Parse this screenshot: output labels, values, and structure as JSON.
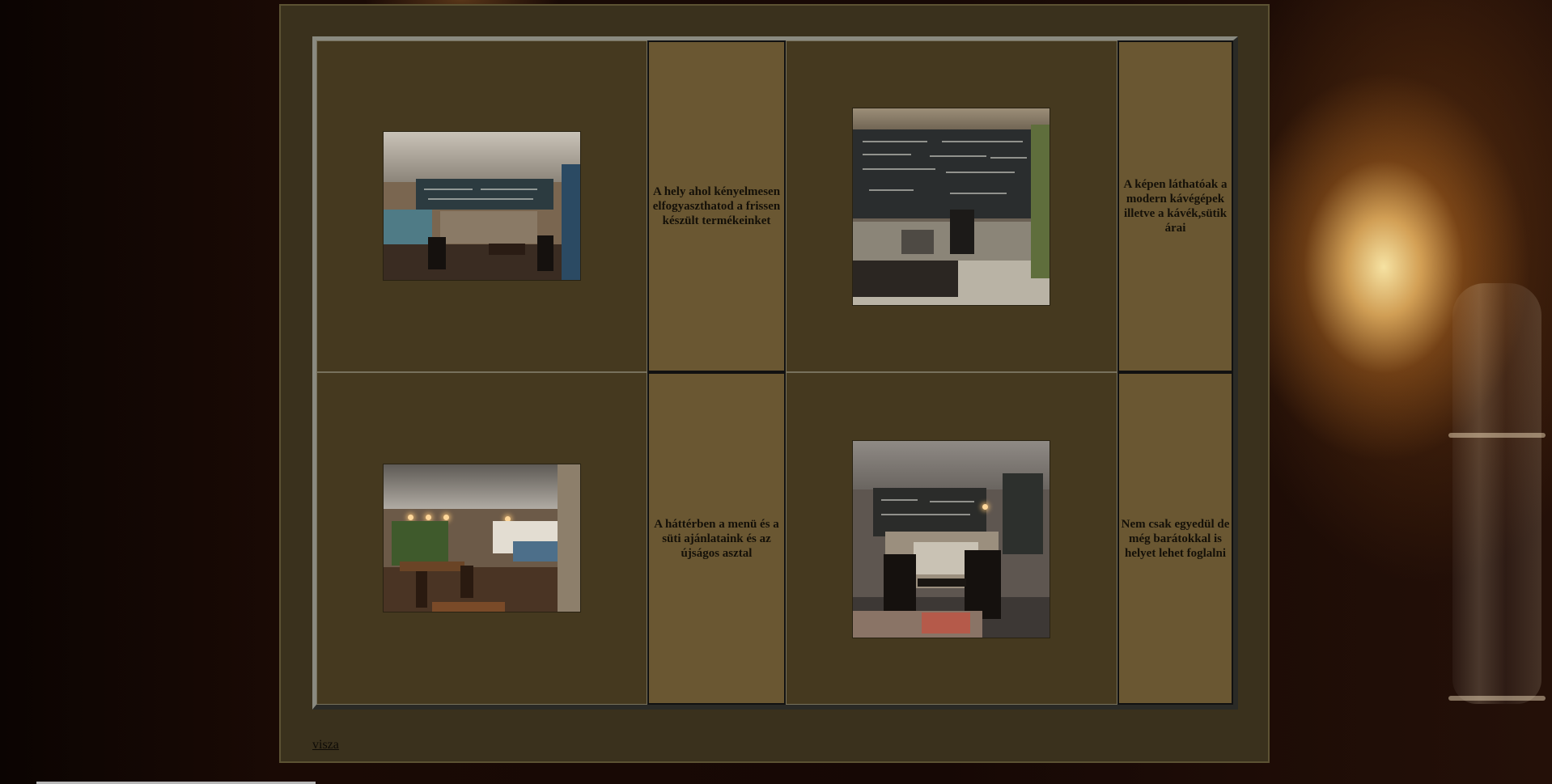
{
  "gallery": {
    "cells": [
      {
        "caption": "A hely ahol kényelmesen elfogyaszthatod a frissen készült termékeinket"
      },
      {
        "caption": "A képen láthatóak a modern kávégépek illetve a kávék,sütik árai"
      },
      {
        "caption": "A háttérben a menü és a süti ajánlataink és az újságos asztal"
      },
      {
        "caption": "Nem csak egyedül de még barátokkal is helyet lehet foglalni"
      }
    ],
    "photos": [
      {
        "alt": "cafe-interior-photo"
      },
      {
        "alt": "coffee-machines-menu-board-photo"
      },
      {
        "alt": "menu-and-magazine-table-photo"
      },
      {
        "alt": "seating-and-pastry-case-photo"
      }
    ]
  },
  "nav": {
    "back_label": "visza"
  },
  "colors": {
    "frame_background": "#3a311d",
    "image_cell_background": "#45391f",
    "text_cell_background": "#6a5732"
  }
}
